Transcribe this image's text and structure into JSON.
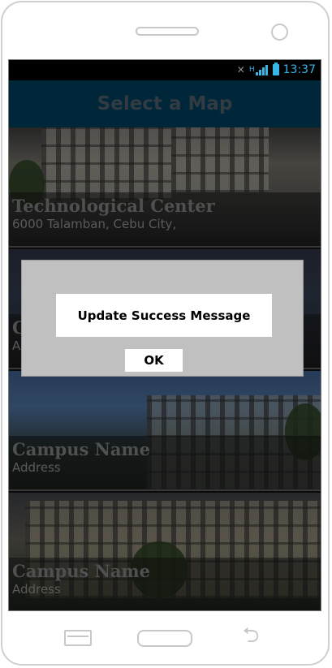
{
  "status_bar": {
    "time": "13:37",
    "network_label": "H",
    "icons": [
      "mute-icon",
      "signal-icon",
      "battery-icon"
    ]
  },
  "header": {
    "title": "Select a Map"
  },
  "campuses": [
    {
      "name": "Technological Center",
      "address": "6000 Talamban, Cebu City,"
    },
    {
      "name": "C",
      "address": "A"
    },
    {
      "name": "Campus Name",
      "address": "Address"
    },
    {
      "name": "Campus Name",
      "address": "Address"
    }
  ],
  "dialog": {
    "message": "Update Success Message",
    "ok_label": "OK"
  },
  "nav": {
    "icons": [
      "recent-apps-icon",
      "home-icon",
      "back-icon"
    ]
  },
  "colors": {
    "header_bg": "#003c58",
    "status_accent": "#38b6e8",
    "dialog_bg": "#c0c0c0"
  }
}
